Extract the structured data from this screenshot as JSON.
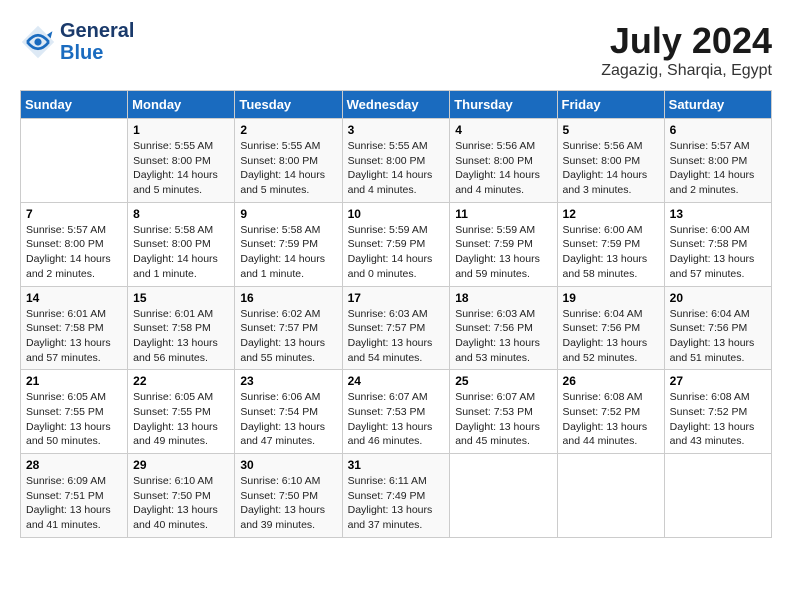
{
  "header": {
    "logo_line1": "General",
    "logo_line2": "Blue",
    "month": "July 2024",
    "location": "Zagazig, Sharqia, Egypt"
  },
  "days_of_week": [
    "Sunday",
    "Monday",
    "Tuesday",
    "Wednesday",
    "Thursday",
    "Friday",
    "Saturday"
  ],
  "weeks": [
    [
      {
        "day": "",
        "sunrise": "",
        "sunset": "",
        "daylight": ""
      },
      {
        "day": "1",
        "sunrise": "Sunrise: 5:55 AM",
        "sunset": "Sunset: 8:00 PM",
        "daylight": "Daylight: 14 hours and 5 minutes."
      },
      {
        "day": "2",
        "sunrise": "Sunrise: 5:55 AM",
        "sunset": "Sunset: 8:00 PM",
        "daylight": "Daylight: 14 hours and 5 minutes."
      },
      {
        "day": "3",
        "sunrise": "Sunrise: 5:55 AM",
        "sunset": "Sunset: 8:00 PM",
        "daylight": "Daylight: 14 hours and 4 minutes."
      },
      {
        "day": "4",
        "sunrise": "Sunrise: 5:56 AM",
        "sunset": "Sunset: 8:00 PM",
        "daylight": "Daylight: 14 hours and 4 minutes."
      },
      {
        "day": "5",
        "sunrise": "Sunrise: 5:56 AM",
        "sunset": "Sunset: 8:00 PM",
        "daylight": "Daylight: 14 hours and 3 minutes."
      },
      {
        "day": "6",
        "sunrise": "Sunrise: 5:57 AM",
        "sunset": "Sunset: 8:00 PM",
        "daylight": "Daylight: 14 hours and 2 minutes."
      }
    ],
    [
      {
        "day": "7",
        "sunrise": "Sunrise: 5:57 AM",
        "sunset": "Sunset: 8:00 PM",
        "daylight": "Daylight: 14 hours and 2 minutes."
      },
      {
        "day": "8",
        "sunrise": "Sunrise: 5:58 AM",
        "sunset": "Sunset: 8:00 PM",
        "daylight": "Daylight: 14 hours and 1 minute."
      },
      {
        "day": "9",
        "sunrise": "Sunrise: 5:58 AM",
        "sunset": "Sunset: 7:59 PM",
        "daylight": "Daylight: 14 hours and 1 minute."
      },
      {
        "day": "10",
        "sunrise": "Sunrise: 5:59 AM",
        "sunset": "Sunset: 7:59 PM",
        "daylight": "Daylight: 14 hours and 0 minutes."
      },
      {
        "day": "11",
        "sunrise": "Sunrise: 5:59 AM",
        "sunset": "Sunset: 7:59 PM",
        "daylight": "Daylight: 13 hours and 59 minutes."
      },
      {
        "day": "12",
        "sunrise": "Sunrise: 6:00 AM",
        "sunset": "Sunset: 7:59 PM",
        "daylight": "Daylight: 13 hours and 58 minutes."
      },
      {
        "day": "13",
        "sunrise": "Sunrise: 6:00 AM",
        "sunset": "Sunset: 7:58 PM",
        "daylight": "Daylight: 13 hours and 57 minutes."
      }
    ],
    [
      {
        "day": "14",
        "sunrise": "Sunrise: 6:01 AM",
        "sunset": "Sunset: 7:58 PM",
        "daylight": "Daylight: 13 hours and 57 minutes."
      },
      {
        "day": "15",
        "sunrise": "Sunrise: 6:01 AM",
        "sunset": "Sunset: 7:58 PM",
        "daylight": "Daylight: 13 hours and 56 minutes."
      },
      {
        "day": "16",
        "sunrise": "Sunrise: 6:02 AM",
        "sunset": "Sunset: 7:57 PM",
        "daylight": "Daylight: 13 hours and 55 minutes."
      },
      {
        "day": "17",
        "sunrise": "Sunrise: 6:03 AM",
        "sunset": "Sunset: 7:57 PM",
        "daylight": "Daylight: 13 hours and 54 minutes."
      },
      {
        "day": "18",
        "sunrise": "Sunrise: 6:03 AM",
        "sunset": "Sunset: 7:56 PM",
        "daylight": "Daylight: 13 hours and 53 minutes."
      },
      {
        "day": "19",
        "sunrise": "Sunrise: 6:04 AM",
        "sunset": "Sunset: 7:56 PM",
        "daylight": "Daylight: 13 hours and 52 minutes."
      },
      {
        "day": "20",
        "sunrise": "Sunrise: 6:04 AM",
        "sunset": "Sunset: 7:56 PM",
        "daylight": "Daylight: 13 hours and 51 minutes."
      }
    ],
    [
      {
        "day": "21",
        "sunrise": "Sunrise: 6:05 AM",
        "sunset": "Sunset: 7:55 PM",
        "daylight": "Daylight: 13 hours and 50 minutes."
      },
      {
        "day": "22",
        "sunrise": "Sunrise: 6:05 AM",
        "sunset": "Sunset: 7:55 PM",
        "daylight": "Daylight: 13 hours and 49 minutes."
      },
      {
        "day": "23",
        "sunrise": "Sunrise: 6:06 AM",
        "sunset": "Sunset: 7:54 PM",
        "daylight": "Daylight: 13 hours and 47 minutes."
      },
      {
        "day": "24",
        "sunrise": "Sunrise: 6:07 AM",
        "sunset": "Sunset: 7:53 PM",
        "daylight": "Daylight: 13 hours and 46 minutes."
      },
      {
        "day": "25",
        "sunrise": "Sunrise: 6:07 AM",
        "sunset": "Sunset: 7:53 PM",
        "daylight": "Daylight: 13 hours and 45 minutes."
      },
      {
        "day": "26",
        "sunrise": "Sunrise: 6:08 AM",
        "sunset": "Sunset: 7:52 PM",
        "daylight": "Daylight: 13 hours and 44 minutes."
      },
      {
        "day": "27",
        "sunrise": "Sunrise: 6:08 AM",
        "sunset": "Sunset: 7:52 PM",
        "daylight": "Daylight: 13 hours and 43 minutes."
      }
    ],
    [
      {
        "day": "28",
        "sunrise": "Sunrise: 6:09 AM",
        "sunset": "Sunset: 7:51 PM",
        "daylight": "Daylight: 13 hours and 41 minutes."
      },
      {
        "day": "29",
        "sunrise": "Sunrise: 6:10 AM",
        "sunset": "Sunset: 7:50 PM",
        "daylight": "Daylight: 13 hours and 40 minutes."
      },
      {
        "day": "30",
        "sunrise": "Sunrise: 6:10 AM",
        "sunset": "Sunset: 7:50 PM",
        "daylight": "Daylight: 13 hours and 39 minutes."
      },
      {
        "day": "31",
        "sunrise": "Sunrise: 6:11 AM",
        "sunset": "Sunset: 7:49 PM",
        "daylight": "Daylight: 13 hours and 37 minutes."
      },
      {
        "day": "",
        "sunrise": "",
        "sunset": "",
        "daylight": ""
      },
      {
        "day": "",
        "sunrise": "",
        "sunset": "",
        "daylight": ""
      },
      {
        "day": "",
        "sunrise": "",
        "sunset": "",
        "daylight": ""
      }
    ]
  ]
}
